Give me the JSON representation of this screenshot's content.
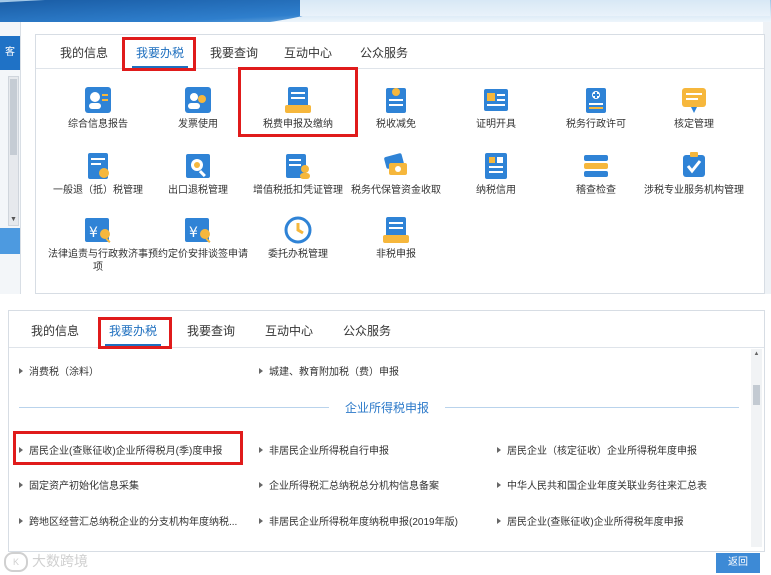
{
  "panel1": {
    "tabs": [
      "我的信息",
      "我要办税",
      "我要查询",
      "互动中心",
      "公众服务"
    ],
    "items": [
      {
        "label": "综合信息报告",
        "icon": "person-card-icon"
      },
      {
        "label": "发票使用",
        "icon": "invoice-people-icon"
      },
      {
        "label": "税费申报及缴纳",
        "icon": "tax-declare-icon"
      },
      {
        "label": "税收减免",
        "icon": "tax-reduction-icon"
      },
      {
        "label": "证明开具",
        "icon": "certificate-icon"
      },
      {
        "label": "税务行政许可",
        "icon": "administrative-permit-icon"
      },
      {
        "label": "核定管理",
        "icon": "approval-manage-icon"
      },
      {
        "label": "一般退（抵）税管理",
        "icon": "refund-document-icon"
      },
      {
        "label": "出口退税管理",
        "icon": "export-refund-icon"
      },
      {
        "label": "增值税抵扣凭证管理",
        "icon": "vat-voucher-icon"
      },
      {
        "label": "税务代保管资金收取",
        "icon": "money-custody-icon"
      },
      {
        "label": "纳税信用",
        "icon": "tax-credit-icon"
      },
      {
        "label": "稽查检查",
        "icon": "inspection-icon"
      },
      {
        "label": "涉税专业服务机构管理",
        "icon": "professional-service-icon"
      },
      {
        "label": "法律追责与行政救济事项",
        "icon": "legal-relief-icon"
      },
      {
        "label": "预约定价安排谈签申请",
        "icon": "pricing-arrangement-icon"
      },
      {
        "label": "委托办税管理",
        "icon": "entrust-tax-icon"
      },
      {
        "label": "非税申报",
        "icon": "non-tax-declare-icon"
      }
    ]
  },
  "left_strip": {
    "tab_text": "客"
  },
  "panel2": {
    "tabs": [
      "我的信息",
      "我要办税",
      "我要查询",
      "互动中心",
      "公众服务"
    ],
    "top_rows": [
      "消费税（涂料）",
      "城建、教育附加税（费）申报"
    ],
    "section_title": "企业所得税申报",
    "rows": [
      [
        "居民企业(查账征收)企业所得税月(季)度申报",
        "非居民企业所得税自行申报",
        "居民企业（核定征收）企业所得税年度申报"
      ],
      [
        "固定资产初始化信息采集",
        "企业所得税汇总纳税总分机构信息备案",
        "中华人民共和国企业年度关联业务往来汇总表"
      ],
      [
        "跨地区经营汇总纳税企业的分支机构年度纳税...",
        "非居民企业所得税年度纳税申报(2019年版)",
        "居民企业(查账征收)企业所得税年度申报"
      ]
    ]
  },
  "return_label": "返回",
  "watermark": "大数跨境",
  "colors": {
    "accent": "#1e6fbf",
    "highlight": "#e01b1b",
    "button": "#3d8ad6"
  }
}
